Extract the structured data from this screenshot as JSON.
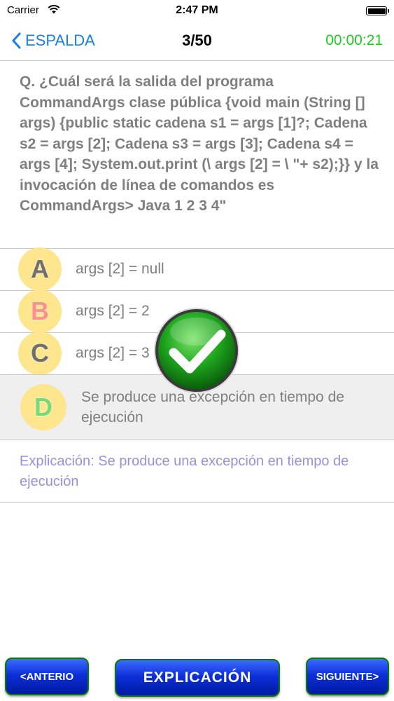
{
  "status_bar": {
    "carrier": "Carrier",
    "time": "2:47 PM"
  },
  "nav": {
    "back_label": "ESPALDA",
    "counter": "3/50",
    "timer": "00:00:21"
  },
  "question": "Q. ¿Cuál será la salida del programa CommandArgs clase pública {void main (String [] args) {public static cadena s1 = args [1]?; Cadena s2 = args [2]; Cadena s3 = args [3]; Cadena s4 = args [4]; System.out.print (\\ args [2] = \\ \"+ s2);}} y la invocación de línea de comandos es CommandArgs> Java 1 2 3 4\"",
  "options": [
    {
      "letter": "A",
      "text": "args [2] = null"
    },
    {
      "letter": "B",
      "text": "args [2] = 2"
    },
    {
      "letter": "C",
      "text": "args [2] = 3"
    },
    {
      "letter": "D",
      "text": "Se produce una excepción en tiempo de ejecución"
    }
  ],
  "explanation": "Explicación: Se produce una excepción en tiempo de ejecución",
  "buttons": {
    "prev": "<ANTERIO",
    "explanation": "EXPLICACIÓN",
    "next": "SIGUIENTE>"
  },
  "colors": {
    "accent": "#1a7fe5",
    "timer": "#1fcb1f",
    "button_blue": "#0d2fd8",
    "explanation_text": "#9b8fd9"
  }
}
